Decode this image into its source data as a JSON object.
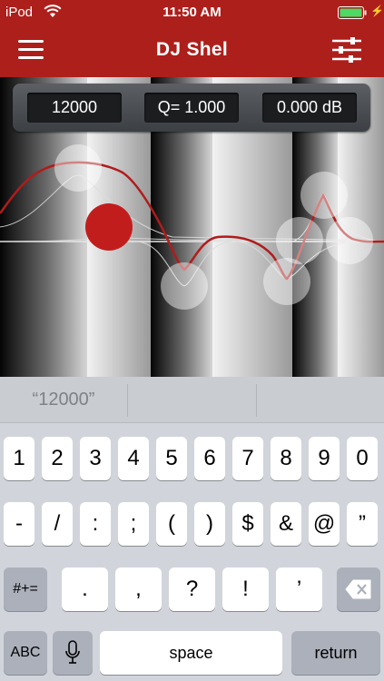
{
  "status": {
    "carrier": "iPod",
    "time": "11:50 AM"
  },
  "nav": {
    "title": "DJ Shel"
  },
  "readout": {
    "frequency": "12000",
    "q": "Q= 1.000",
    "gain": "0.000 dB"
  },
  "suggestion": {
    "text": "“12000”"
  },
  "keyboard": {
    "row1": [
      "1",
      "2",
      "3",
      "4",
      "5",
      "6",
      "7",
      "8",
      "9",
      "0"
    ],
    "row2": [
      "-",
      "/",
      ":",
      ";",
      "(",
      ")",
      "$",
      "&",
      "@",
      "”"
    ],
    "row3": [
      ".",
      ",",
      "?",
      "!",
      "’"
    ],
    "shift_label": "#+=",
    "abc_label": "ABC",
    "space_label": "space",
    "return_label": "return"
  },
  "icons": [
    "wifi-icon",
    "battery-icon",
    "menu-icon",
    "sliders-icon",
    "microphone-icon",
    "delete-icon"
  ],
  "colors": {
    "accent": "#ad1f1b",
    "curve": "#b01c1c"
  }
}
